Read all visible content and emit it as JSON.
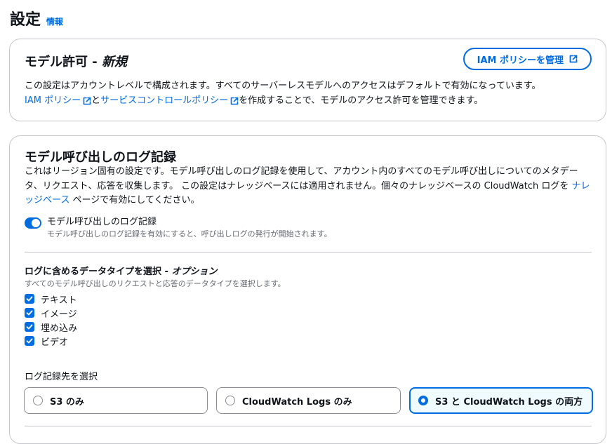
{
  "header": {
    "title": "設定",
    "info_link": "情報"
  },
  "model_access": {
    "title": "モデル許可",
    "title_separator": " - ",
    "title_suffix": "新規",
    "manage_button": "IAM ポリシーを管理",
    "desc_line1": "この設定はアカウントレベルで構成されます。すべてのサーバーレスモデルへのアクセスはデフォルトで有効になっています。",
    "iam_link": "IAM ポリシー",
    "connector": "と",
    "scp_link": "サービスコントロールポリシー",
    "desc_line2_tail": "を作成することで、モデルのアクセス許可を管理できます。"
  },
  "invocation_logging": {
    "title": "モデル呼び出しのログ記録",
    "desc_part1": "これはリージョン固有の設定です。モデル呼び出しのログ記録を使用して、アカウント内のすべてのモデル呼び出しについてのメタデータ、リクエスト、応答を収集します。 この設定はナレッジベースには適用されません。個々のナレッジベースの CloudWatch ログを ",
    "kb_link": "ナレッジベース",
    "desc_part2": " ページで有効にしてください。",
    "toggle": {
      "label": "モデル呼び出しのログ記録",
      "description": "モデル呼び出しのログ記録を有効にすると、呼び出しログの発行が開始されます。",
      "enabled": true
    },
    "data_types": {
      "title": "ログに含めるデータタイプを選択",
      "title_separator": " - ",
      "title_suffix": "オプション",
      "description": "すべてのモデル呼び出しのリクエストと応答のデータタイプを選択します。",
      "options": [
        {
          "label": "テキスト",
          "checked": true
        },
        {
          "label": "イメージ",
          "checked": true
        },
        {
          "label": "埋め込み",
          "checked": true
        },
        {
          "label": "ビデオ",
          "checked": true
        }
      ]
    },
    "destination": {
      "label": "ログ記録先を選択",
      "options": [
        {
          "label": "S3 のみ",
          "selected": false
        },
        {
          "label": "CloudWatch Logs のみ",
          "selected": false
        },
        {
          "label": "S3 と CloudWatch Logs の両方",
          "selected": true
        }
      ]
    }
  },
  "colors": {
    "accent": "#006ce0",
    "border": "#c6c6cd",
    "muted_text": "#656871",
    "selected_bg": "#f0fbff"
  }
}
